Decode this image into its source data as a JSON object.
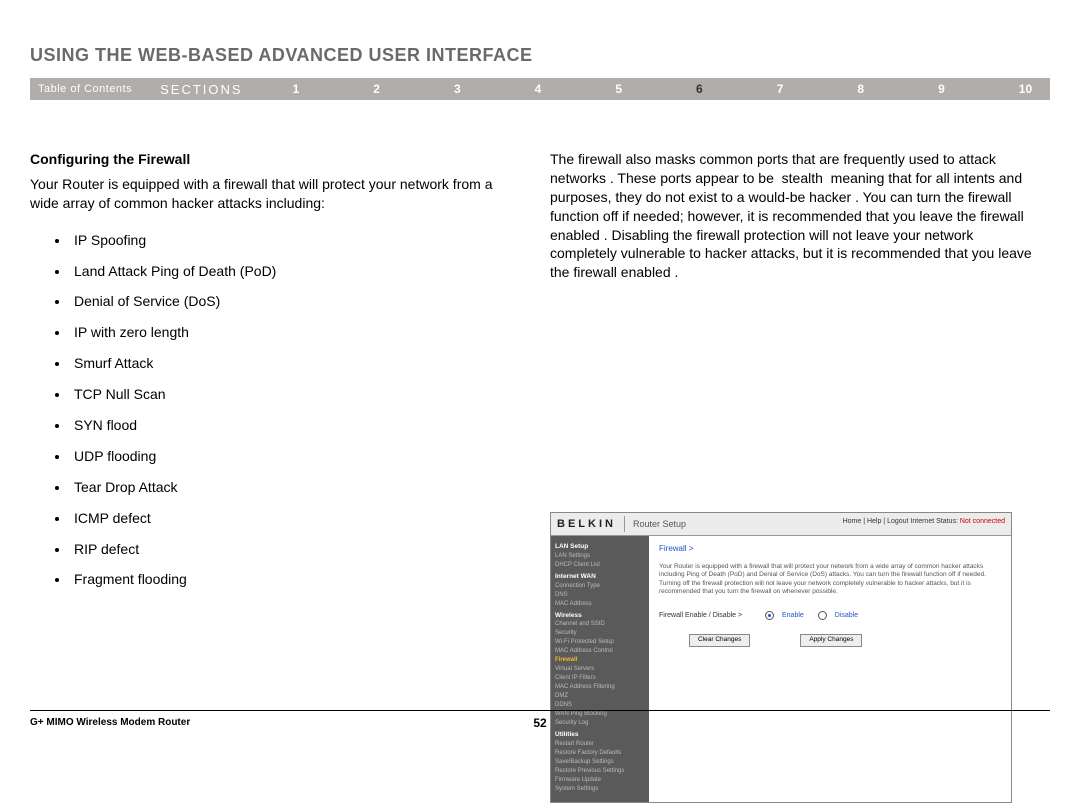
{
  "page_title": "USING THE WEB-BASED ADVANCED USER INTERFACE",
  "nav": {
    "toc": "Table of Contents",
    "sections_label": "SECTIONS",
    "numbers": [
      "1",
      "2",
      "3",
      "4",
      "5",
      "6",
      "7",
      "8",
      "9",
      "10"
    ],
    "current": "6"
  },
  "left": {
    "subheading": "Configuring the Firewall",
    "intro": "Your Router is equipped with a firewall that will protect your network from a wide array of common hacker attacks including:",
    "bullets": [
      "IP Spoofing",
      "Land Attack Ping of Death (PoD)",
      "Denial of Service (DoS)",
      "IP with zero length",
      "Smurf Attack",
      "TCP Null Scan",
      "SYN flood",
      "UDP flooding",
      "Tear Drop Attack",
      "ICMP defect",
      "RIP defect",
      "Fragment flooding"
    ]
  },
  "right": {
    "para": "The firewall also masks common ports that are frequently used to attack networks . These ports appear to be  stealth  meaning that for all intents and purposes, they do not exist to a would-be hacker . You can turn the firewall function off if needed; however, it is recommended that you leave the firewall enabled . Disabling the firewall protection will not leave your network completely vulnerable to hacker attacks, but it is recommended that you leave the firewall enabled ."
  },
  "screenshot": {
    "brand": "BELKIN",
    "subtitle": "Router Setup",
    "header_links": "Home | Help | Logout   Internet Status:",
    "header_status": "Not connected",
    "sidebar": {
      "g1_hd": "LAN Setup",
      "g1_items": [
        "LAN Settings",
        "DHCP Client List"
      ],
      "g2_hd": "Internet WAN",
      "g2_items": [
        "Connection Type",
        "DNS",
        "MAC Address"
      ],
      "g3_hd": "Wireless",
      "g3_items": [
        "Channel and SSID",
        "Security",
        "Wi-Fi Protected Setup",
        "MAC Address Control"
      ],
      "fw": "Firewall",
      "g4_items": [
        "Virtual Servers",
        "Client IP Filters",
        "MAC Address Filtering",
        "DMZ",
        "DDNS",
        "WAN Ping Blocking",
        "Security Log"
      ],
      "g5_hd": "Utilities",
      "g5_items": [
        "Restart Router",
        "Restore Factory Defaults",
        "Save/Backup Settings",
        "Restore Previous Settings",
        "Firmware Update",
        "System Settings"
      ]
    },
    "main": {
      "crumb": "Firewall >",
      "para": "Your Router is equipped with a firewall that will protect your network from a wide array of common hacker attacks including Ping of Death (PoD) and Denial of Service (DoS) attacks. You can turn the firewall function off if needed. Turning off the firewall protection will not leave your network completely vulnerable to hacker attacks, but it is recommended that you turn the firewall on whenever possible.",
      "row_label": "Firewall Enable / Disable >",
      "opt_enable": "Enable",
      "opt_disable": "Disable",
      "btn_clear": "Clear Changes",
      "btn_apply": "Apply Changes"
    }
  },
  "footer": {
    "product": "G+ MIMO Wireless Modem Router",
    "page_no": "52"
  }
}
